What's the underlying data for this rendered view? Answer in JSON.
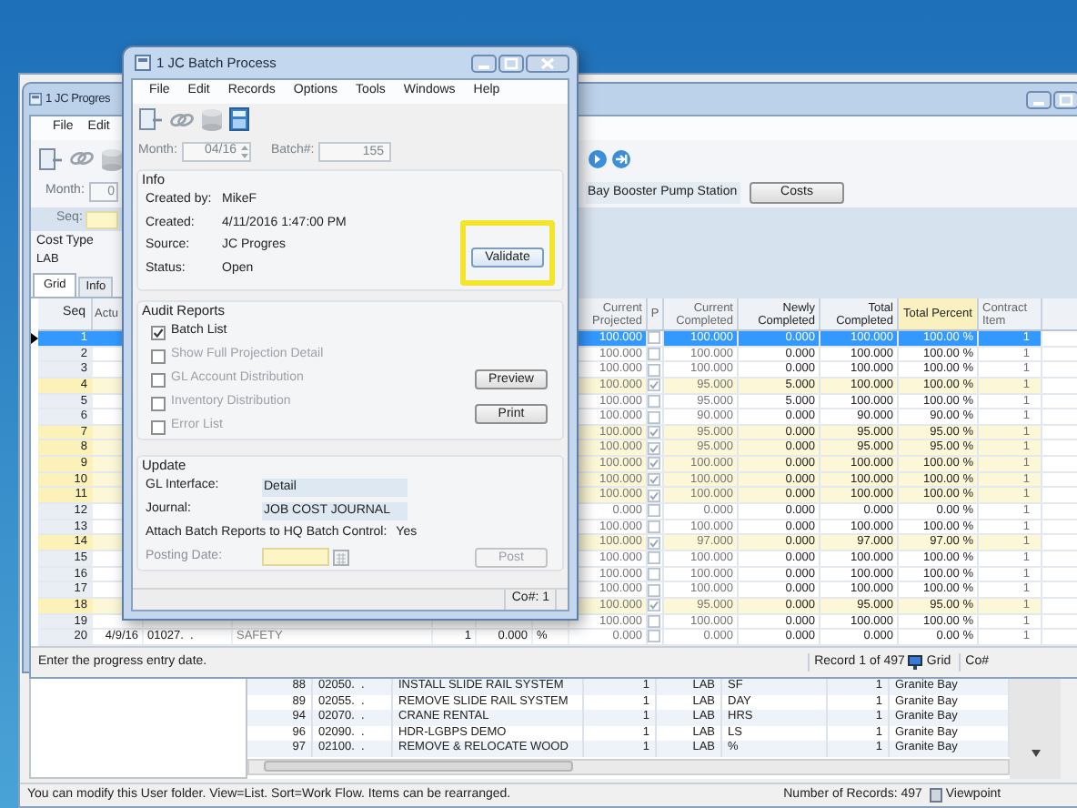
{
  "back_window": {
    "rows": [
      {
        "number": "88",
        "code": "02050.  .",
        "description": "INSTALL SLIDE RAIL SYSTEM",
        "quantity": "1",
        "cost_type": "LAB",
        "unit": "SF",
        "item": "1",
        "location": "Granite Bay"
      },
      {
        "number": "89",
        "code": "02055.  .",
        "description": "REMOVE SLIDE RAIL SYSTEM",
        "quantity": "1",
        "cost_type": "LAB",
        "unit": "DAY",
        "item": "1",
        "location": "Granite Bay"
      },
      {
        "number": "94",
        "code": "02070.  .",
        "description": "CRANE RENTAL",
        "quantity": "1",
        "cost_type": "LAB",
        "unit": "HRS",
        "item": "1",
        "location": "Granite Bay"
      },
      {
        "number": "96",
        "code": "02090.  .",
        "description": "HDR-LGBPS DEMO",
        "quantity": "1",
        "cost_type": "LAB",
        "unit": "LS",
        "item": "1",
        "location": "Granite Bay"
      },
      {
        "number": "97",
        "code": "02100.  .",
        "description": "REMOVE & RELOCATE WOOD",
        "quantity": "1",
        "cost_type": "LAB",
        "unit": "%",
        "item": "1",
        "location": "Granite Bay"
      }
    ],
    "status_bar": {
      "message": "You can modify this User folder. View=List. Sort=Work Flow. Items can be rearranged.",
      "record_count": "Number of Records: 497",
      "viewpoint": "Viewpoint"
    }
  },
  "progress_window": {
    "title": "1 JC Progres",
    "menu": [
      "File",
      "Edit"
    ],
    "month_label": "Month:",
    "month_value": "0",
    "description": "Bay Booster Pump Station",
    "costs_button": "Costs",
    "seq_label": "Seq:",
    "cost_type_label": "Cost Type",
    "cost_type_value": "LAB",
    "tabs": [
      {
        "label": "Grid",
        "selected": true
      },
      {
        "label": "Info",
        "selected": false
      }
    ],
    "seq_header": "Seq",
    "actual_header": "Actu",
    "checkbox_header": "P",
    "columns": [
      "Current Projected",
      "Current Completed",
      "Newly Completed",
      "Total Completed",
      "Total Percent",
      "Contract Item"
    ],
    "rows": [
      {
        "seq": "1",
        "selected": true,
        "checked": false,
        "cells": [
          "100.000",
          "100.000",
          "0.000",
          "100.000",
          "100.00 %",
          "1"
        ]
      },
      {
        "seq": "2",
        "selected": false,
        "checked": false,
        "cells": [
          "100.000",
          "100.000",
          "0.000",
          "100.000",
          "100.00 %",
          "1"
        ]
      },
      {
        "seq": "3",
        "selected": false,
        "checked": false,
        "cells": [
          "100.000",
          "100.000",
          "0.000",
          "100.000",
          "100.00 %",
          "1"
        ]
      },
      {
        "seq": "4",
        "selected": false,
        "checked": true,
        "cells": [
          "100.000",
          "95.000",
          "5.000",
          "100.000",
          "100.00 %",
          "1"
        ]
      },
      {
        "seq": "5",
        "selected": false,
        "checked": false,
        "cells": [
          "100.000",
          "95.000",
          "5.000",
          "100.000",
          "100.00 %",
          "1"
        ]
      },
      {
        "seq": "6",
        "selected": false,
        "checked": false,
        "cells": [
          "100.000",
          "90.000",
          "0.000",
          "90.000",
          "90.00 %",
          "1"
        ]
      },
      {
        "seq": "7",
        "selected": false,
        "checked": true,
        "cells": [
          "100.000",
          "95.000",
          "0.000",
          "95.000",
          "95.00 %",
          "1"
        ]
      },
      {
        "seq": "8",
        "selected": false,
        "checked": true,
        "cells": [
          "100.000",
          "95.000",
          "0.000",
          "95.000",
          "95.00 %",
          "1"
        ]
      },
      {
        "seq": "9",
        "selected": false,
        "checked": true,
        "cells": [
          "100.000",
          "100.000",
          "0.000",
          "100.000",
          "100.00 %",
          "1"
        ]
      },
      {
        "seq": "10",
        "selected": false,
        "checked": true,
        "cells": [
          "100.000",
          "100.000",
          "0.000",
          "100.000",
          "100.00 %",
          "1"
        ]
      },
      {
        "seq": "11",
        "selected": false,
        "checked": true,
        "cells": [
          "100.000",
          "100.000",
          "0.000",
          "100.000",
          "100.00 %",
          "1"
        ]
      },
      {
        "seq": "12",
        "selected": false,
        "checked": false,
        "cells": [
          "0.000",
          "0.000",
          "0.000",
          "0.000",
          "0.00 %",
          "1"
        ]
      },
      {
        "seq": "13",
        "selected": false,
        "checked": false,
        "cells": [
          "100.000",
          "100.000",
          "0.000",
          "100.000",
          "100.00 %",
          "1"
        ]
      },
      {
        "seq": "14",
        "selected": false,
        "checked": true,
        "cells": [
          "100.000",
          "97.000",
          "0.000",
          "97.000",
          "97.00 %",
          "1"
        ]
      },
      {
        "seq": "15",
        "selected": false,
        "checked": false,
        "cells": [
          "100.000",
          "100.000",
          "0.000",
          "100.000",
          "100.00 %",
          "1"
        ]
      },
      {
        "seq": "16",
        "selected": false,
        "checked": false,
        "cells": [
          "100.000",
          "100.000",
          "0.000",
          "100.000",
          "100.00 %",
          "1"
        ]
      },
      {
        "seq": "17",
        "selected": false,
        "checked": false,
        "cells": [
          "100.000",
          "100.000",
          "0.000",
          "100.000",
          "100.00 %",
          "1"
        ]
      },
      {
        "seq": "18",
        "selected": false,
        "checked": true,
        "cells": [
          "100.000",
          "95.000",
          "0.000",
          "95.000",
          "95.00 %",
          "1"
        ]
      },
      {
        "seq": "19",
        "selected": false,
        "checked": false,
        "cells": [
          "100.000",
          "100.000",
          "0.000",
          "100.000",
          "100.00 %",
          "1"
        ]
      },
      {
        "seq": "20",
        "selected": false,
        "checked": false,
        "left_cells": [
          "4/9/16",
          "01027.  .",
          "SAFETY",
          "1",
          "0.000",
          "%"
        ],
        "cells": [
          "0.000",
          "0.000",
          "0.000",
          "0.000",
          "0.00 %",
          "1"
        ]
      }
    ],
    "status_bar": {
      "message": "Enter the progress entry date.",
      "record": "Record 1 of 497",
      "view": "Grid",
      "company": "Co#"
    }
  },
  "dialog": {
    "title": "1 JC Batch Process",
    "menu": [
      "File",
      "Edit",
      "Records",
      "Options",
      "Tools",
      "Windows",
      "Help"
    ],
    "month_label": "Month:",
    "month_value": "04/16",
    "batch_label": "Batch#:",
    "batch_value": "155",
    "info": {
      "title": "Info",
      "fields": [
        {
          "label": "Created by:",
          "value": "MikeF"
        },
        {
          "label": "Created:",
          "value": "4/11/2016 1:47:00 PM"
        },
        {
          "label": "Source:",
          "value": "JC Progres"
        },
        {
          "label": "Status:",
          "value": "Open"
        }
      ],
      "validate_button": {
        "label": "Validate",
        "highlighted": true
      }
    },
    "audit": {
      "title": "Audit Reports",
      "options": [
        {
          "label": "Batch List",
          "checked": true,
          "disabled": false
        },
        {
          "label": "Show Full Projection Detail",
          "checked": false,
          "disabled": true
        },
        {
          "label": "GL Account Distribution",
          "checked": false,
          "disabled": true
        },
        {
          "label": "Inventory Distribution",
          "checked": false,
          "disabled": true
        },
        {
          "label": "Error List",
          "checked": false,
          "disabled": true
        }
      ],
      "preview_button": "Preview",
      "print_button": "Print"
    },
    "update": {
      "title": "Update",
      "gl_label": "GL Interface:",
      "gl_value": "Detail",
      "journal_label": "Journal:",
      "journal_value": "JOB COST JOURNAL",
      "attach_label": "Attach Batch Reports to HQ Batch Control:",
      "attach_value": "Yes",
      "posting_label": "Posting Date:",
      "post_button": {
        "label": "Post",
        "disabled": true
      }
    },
    "status_bar": {
      "company": "Co#: 1"
    }
  }
}
